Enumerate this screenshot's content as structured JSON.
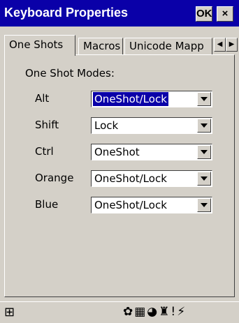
{
  "window": {
    "title": "Keyboard Properties",
    "ok_label": "OK",
    "close_label": "×"
  },
  "tabs": [
    "One Shots",
    "Macros",
    "Unicode Mapp"
  ],
  "scroll": {
    "left": "◀",
    "right": "▶"
  },
  "content": {
    "heading": "One Shot Modes:",
    "rows": [
      {
        "label": "Alt",
        "value": "OneShot/Lock"
      },
      {
        "label": "Shift",
        "value": "Lock"
      },
      {
        "label": "Ctrl",
        "value": "OneShot"
      },
      {
        "label": "Orange",
        "value": "OneShot/Lock"
      },
      {
        "label": "Blue",
        "value": "OneShot/Lock"
      }
    ]
  },
  "taskbar": {
    "start_glyph": "⊞",
    "tray_glyphs": "✿▦◕♜!⚡"
  },
  "colors": {
    "titlebar": "#0a00a8",
    "face": "#d4d0c8"
  }
}
